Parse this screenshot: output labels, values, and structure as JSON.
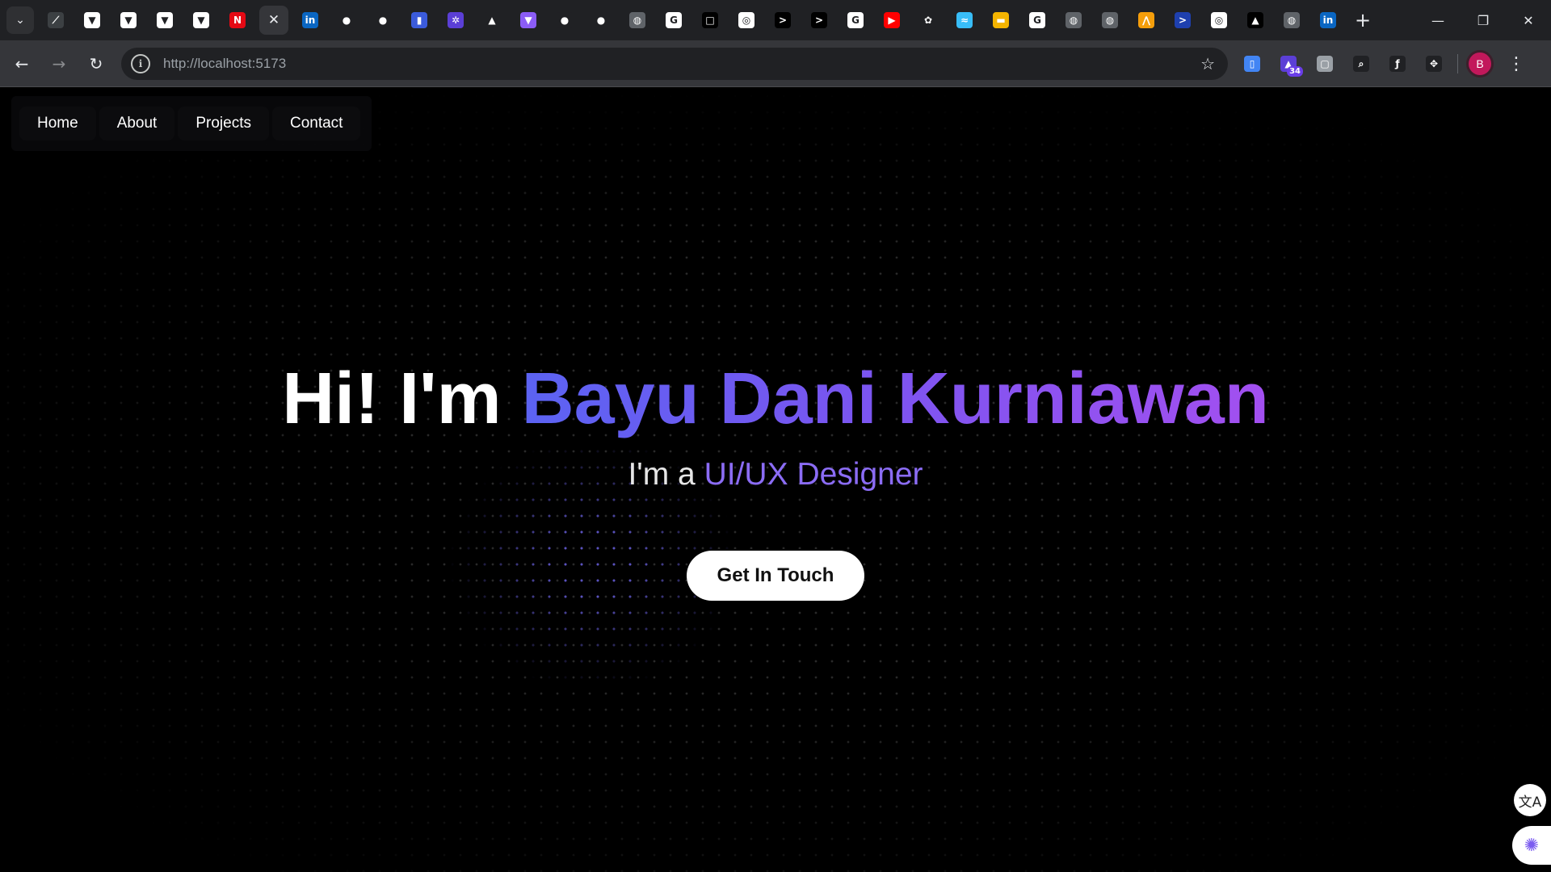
{
  "browser": {
    "tabs": [
      {
        "icon": "tab-search-icon"
      },
      {
        "icon": "pen-icon",
        "color": "#3c4043",
        "glyph": "⟋"
      },
      {
        "icon": "vercel-icon",
        "color": "#ffffff",
        "glyph": "▼"
      },
      {
        "icon": "vercel-icon",
        "color": "#ffffff",
        "glyph": "▼"
      },
      {
        "icon": "vercel-icon",
        "color": "#ffffff",
        "glyph": "▼"
      },
      {
        "icon": "vercel-icon",
        "color": "#ffffff",
        "glyph": "▼"
      },
      {
        "icon": "netflix-icon",
        "color": "#e50914",
        "glyph": "N"
      },
      {
        "icon": "close-icon",
        "active": true
      },
      {
        "icon": "linkedin-icon",
        "color": "#0a66c2",
        "glyph": "in"
      },
      {
        "icon": "github-icon",
        "color": "#202124",
        "glyph": "●"
      },
      {
        "icon": "github-icon",
        "color": "#202124",
        "glyph": "●"
      },
      {
        "icon": "chart-icon",
        "color": "#3b5bdb",
        "glyph": "▮"
      },
      {
        "icon": "settings-icon",
        "color": "#5b3fd6",
        "glyph": "✲"
      },
      {
        "icon": "nav-arrow-icon",
        "color": "#202124",
        "glyph": "▲"
      },
      {
        "icon": "vite-icon",
        "color": "#8b5cf6",
        "glyph": "▼"
      },
      {
        "icon": "github-icon",
        "color": "#202124",
        "glyph": "●"
      },
      {
        "icon": "github-icon",
        "color": "#202124",
        "glyph": "●"
      },
      {
        "icon": "globe-icon",
        "color": "#5f6368",
        "glyph": "◍"
      },
      {
        "icon": "google-icon",
        "color": "#ffffff",
        "glyph": "G"
      },
      {
        "icon": "square-icon",
        "color": "#000000",
        "glyph": "□"
      },
      {
        "icon": "chrome-icon",
        "color": "#ffffff",
        "glyph": "◎"
      },
      {
        "icon": "terminal-icon",
        "color": "#000000",
        "glyph": ">"
      },
      {
        "icon": "terminal-icon",
        "color": "#000000",
        "glyph": ">"
      },
      {
        "icon": "google-icon",
        "color": "#ffffff",
        "glyph": "G"
      },
      {
        "icon": "youtube-icon",
        "color": "#ff0000",
        "glyph": "▶"
      },
      {
        "icon": "openai-icon",
        "color": "#202124",
        "glyph": "✿"
      },
      {
        "icon": "tailwind-icon",
        "color": "#38bdf8",
        "glyph": "≈"
      },
      {
        "icon": "slides-icon",
        "color": "#f4b400",
        "glyph": "▬"
      },
      {
        "icon": "google-icon",
        "color": "#ffffff",
        "glyph": "G"
      },
      {
        "icon": "globe-icon",
        "color": "#5f6368",
        "glyph": "◍"
      },
      {
        "icon": "globe-icon",
        "color": "#5f6368",
        "glyph": "◍"
      },
      {
        "icon": "mountain-icon",
        "color": "#f59e0b",
        "glyph": "⋀"
      },
      {
        "icon": "powershell-icon",
        "color": "#1e40af",
        "glyph": ">"
      },
      {
        "icon": "chrome-icon",
        "color": "#ffffff",
        "glyph": "◎"
      },
      {
        "icon": "triangle-icon",
        "color": "#000000",
        "glyph": "▲"
      },
      {
        "icon": "globe-icon",
        "color": "#5f6368",
        "glyph": "◍"
      },
      {
        "icon": "linkedin-icon",
        "color": "#0a66c2",
        "glyph": "in"
      }
    ],
    "new_tab_glyph": "+",
    "window": {
      "minimize": "—",
      "restore": "❐",
      "close": "✕"
    },
    "toolbar": {
      "back": "←",
      "forward": "→",
      "reload": "↻",
      "url": "http://localhost:5173",
      "star": "☆",
      "info": "i"
    },
    "extensions": [
      {
        "icon": "docs-icon",
        "color": "#4285f4",
        "glyph": "▯"
      },
      {
        "icon": "graduation-cap-icon",
        "color": "#5b3fd6",
        "glyph": "▲",
        "badge": "34"
      },
      {
        "icon": "extension-square-icon",
        "color": "#9aa0a6",
        "glyph": "▢"
      },
      {
        "icon": "magnifier-icon",
        "color": "#202124",
        "glyph": "⌕"
      },
      {
        "icon": "function-icon",
        "color": "#202124",
        "glyph": "ƒ"
      },
      {
        "icon": "puzzle-icon",
        "color": "#202124",
        "glyph": "✥"
      }
    ],
    "profile_initial": "B",
    "menu": "⋮"
  },
  "site": {
    "nav": [
      "Home",
      "About",
      "Projects",
      "Contact"
    ],
    "hero": {
      "greeting": "Hi! I'm ",
      "name": "Bayu Dani Kurniawan",
      "sub_prefix": "I'm a ",
      "role": "UI/UX Designer",
      "cta": "Get In Touch"
    },
    "floating": {
      "translate": "文A",
      "brain": "✺"
    },
    "colors": {
      "accent_start": "#5b63f2",
      "accent_end": "#a34ff0",
      "role": "#8b6cf5"
    }
  }
}
